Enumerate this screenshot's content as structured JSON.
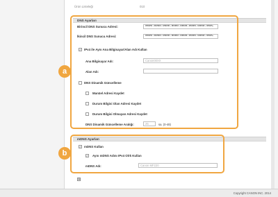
{
  "top": {
    "label": "Ürün Listeleği",
    "value": "010"
  },
  "dns": {
    "title": "DNS Ayarları",
    "primary_label": "Birincil DNS Sunucu Adresi:",
    "primary_value": "0000:0000:0000:0000:0000:0000:0000:000C",
    "secondary_label": "İkincil DNS Sunucu Adresi:",
    "secondary_value": "0000:0000:0000:0000:0000:0000:0000:000C",
    "same_host_label": "IPv4 ile Aynı Ana Bilgisayar/Alan Adı Kullan",
    "same_host_checked": "✓",
    "host_label": "Ana Bilgisayar Adı:",
    "host_value": "Canon00XX",
    "domain_label": "Alan Adı:",
    "domain_value": "",
    "dynamic_label": "DNS Dinamik Güncelleme",
    "manual_label": "Manüel Adresi Kaydet",
    "stateful_label": "Durum Bilgisi Olan Adresi Kaydet",
    "stateless_label": "Durum Bilgisi Olmayan Adresi Kaydet",
    "interval_label": "DNS Dinamik Güncelleme Aralığı:",
    "interval_value": "25",
    "interval_unit": "sa. (0-48)"
  },
  "mdns": {
    "title": "mDNS Ayarları",
    "use_label": "mDNS Kullan",
    "use_checked": "✓",
    "same_name_label": "Aynı mDNS Adını IPv4 Olrk Kullan",
    "same_name_checked": "✓",
    "name_label": "mDNS Adı:",
    "name_value": "Canon MF220"
  },
  "callouts": {
    "a": "a",
    "b": "b"
  },
  "footer": {
    "copyright": "Copyright CANON INC. 2014"
  }
}
